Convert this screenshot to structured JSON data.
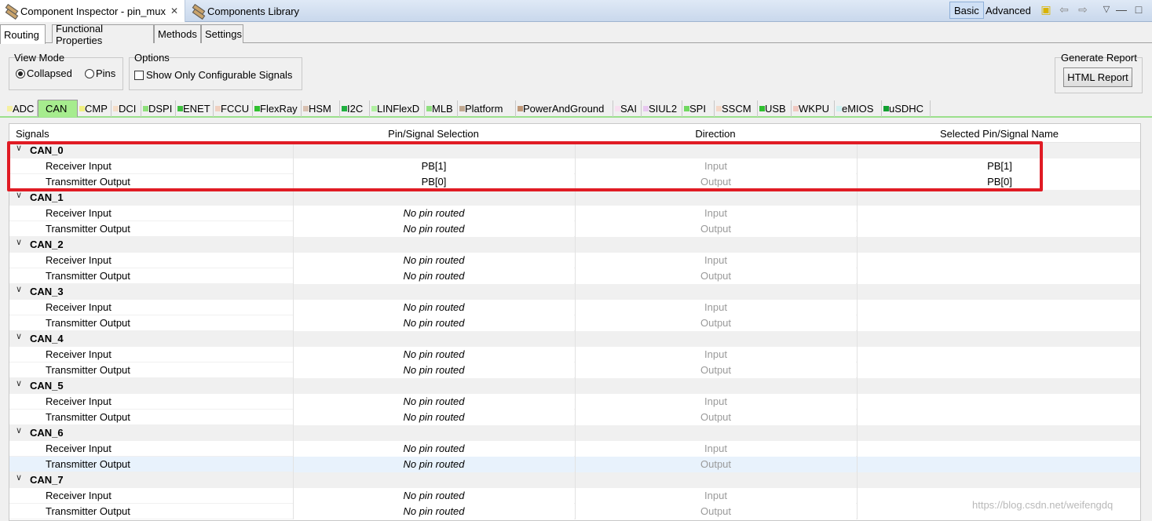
{
  "view_tabs": [
    {
      "label": "Component Inspector - pin_mux",
      "icon": "component-icon",
      "closable": true
    },
    {
      "label": "Components Library",
      "icon": "component-icon",
      "closable": false
    }
  ],
  "close_glyph": "✕",
  "mode": {
    "basic_label": "Basic",
    "advanced_label": "Advanced",
    "selected": "Basic"
  },
  "toolbar_icons": [
    "new-file-icon",
    "back-icon",
    "forward-icon",
    "view-menu-icon",
    "maximize-icon"
  ],
  "subtabs": [
    "Routing",
    "Functional Properties",
    "Methods",
    "Settings"
  ],
  "active_subtab": "Routing",
  "view_mode": {
    "title": "View Mode",
    "options": [
      "Collapsed",
      "Pins"
    ],
    "selected": "Collapsed"
  },
  "options": {
    "title": "Options",
    "checkbox_label": "Show Only Configurable Signals",
    "checked": false
  },
  "report": {
    "title": "Generate Report",
    "button_label": "HTML Report"
  },
  "peripheral_tabs": [
    {
      "label": "ADC",
      "color": "#f5f0a0"
    },
    {
      "label": "CAN",
      "color": "#a6ec8e"
    },
    {
      "label": "CMP",
      "color": "#f0f080"
    },
    {
      "label": "DCI",
      "color": "#f5ddc8"
    },
    {
      "label": "DSPI",
      "color": "#8ee07a"
    },
    {
      "label": "ENET",
      "color": "#40c040"
    },
    {
      "label": "FCCU",
      "color": "#f0d0c0"
    },
    {
      "label": "FlexRay",
      "color": "#30c030"
    },
    {
      "label": "HSM",
      "color": "#d8c0b0"
    },
    {
      "label": "I2C",
      "color": "#20b040"
    },
    {
      "label": "LINFlexD",
      "color": "#b0f0a0"
    },
    {
      "label": "MLB",
      "color": "#90e080"
    },
    {
      "label": "Platform",
      "color": "#c0a890"
    },
    {
      "label": "PowerAndGround",
      "color": "#c09878"
    },
    {
      "label": "SAI",
      "color": "#f8e0f0"
    },
    {
      "label": "SIUL2",
      "color": "#e8c8f0"
    },
    {
      "label": "SPI",
      "color": "#70d860"
    },
    {
      "label": "SSCM",
      "color": "#f4d8c8"
    },
    {
      "label": "USB",
      "color": "#30c030"
    },
    {
      "label": "WKPU",
      "color": "#f0c8c0"
    },
    {
      "label": "eMIOS",
      "color": "#d0f0f0"
    },
    {
      "label": "uSDHC",
      "color": "#10a030"
    }
  ],
  "active_peripheral": "CAN",
  "table": {
    "headers": [
      "Signals",
      "Pin/Signal Selection",
      "Direction",
      "Selected Pin/Signal Name"
    ],
    "groups": [
      {
        "name": "CAN_0",
        "rows": [
          {
            "signal": "Receiver Input",
            "selection": "PB[1]",
            "direction": "Input",
            "name": "PB[1]"
          },
          {
            "signal": "Transmitter Output",
            "selection": "PB[0]",
            "direction": "Output",
            "name": "PB[0]"
          }
        ]
      },
      {
        "name": "CAN_1",
        "rows": [
          {
            "signal": "Receiver Input",
            "selection": "No pin routed",
            "direction": "Input",
            "name": ""
          },
          {
            "signal": "Transmitter Output",
            "selection": "No pin routed",
            "direction": "Output",
            "name": ""
          }
        ]
      },
      {
        "name": "CAN_2",
        "rows": [
          {
            "signal": "Receiver Input",
            "selection": "No pin routed",
            "direction": "Input",
            "name": ""
          },
          {
            "signal": "Transmitter Output",
            "selection": "No pin routed",
            "direction": "Output",
            "name": ""
          }
        ]
      },
      {
        "name": "CAN_3",
        "rows": [
          {
            "signal": "Receiver Input",
            "selection": "No pin routed",
            "direction": "Input",
            "name": ""
          },
          {
            "signal": "Transmitter Output",
            "selection": "No pin routed",
            "direction": "Output",
            "name": ""
          }
        ]
      },
      {
        "name": "CAN_4",
        "rows": [
          {
            "signal": "Receiver Input",
            "selection": "No pin routed",
            "direction": "Input",
            "name": ""
          },
          {
            "signal": "Transmitter Output",
            "selection": "No pin routed",
            "direction": "Output",
            "name": ""
          }
        ]
      },
      {
        "name": "CAN_5",
        "rows": [
          {
            "signal": "Receiver Input",
            "selection": "No pin routed",
            "direction": "Input",
            "name": ""
          },
          {
            "signal": "Transmitter Output",
            "selection": "No pin routed",
            "direction": "Output",
            "name": ""
          }
        ]
      },
      {
        "name": "CAN_6",
        "rows": [
          {
            "signal": "Receiver Input",
            "selection": "No pin routed",
            "direction": "Input",
            "name": ""
          },
          {
            "signal": "Transmitter Output",
            "selection": "No pin routed",
            "direction": "Output",
            "name": "",
            "selected": true
          }
        ]
      },
      {
        "name": "CAN_7",
        "rows": [
          {
            "signal": "Receiver Input",
            "selection": "No pin routed",
            "direction": "Input",
            "name": ""
          },
          {
            "signal": "Transmitter Output",
            "selection": "No pin routed",
            "direction": "Output",
            "name": ""
          }
        ]
      }
    ]
  },
  "highlight_color": "#e01b24",
  "watermark": "https://blog.csdn.net/weifengdq"
}
